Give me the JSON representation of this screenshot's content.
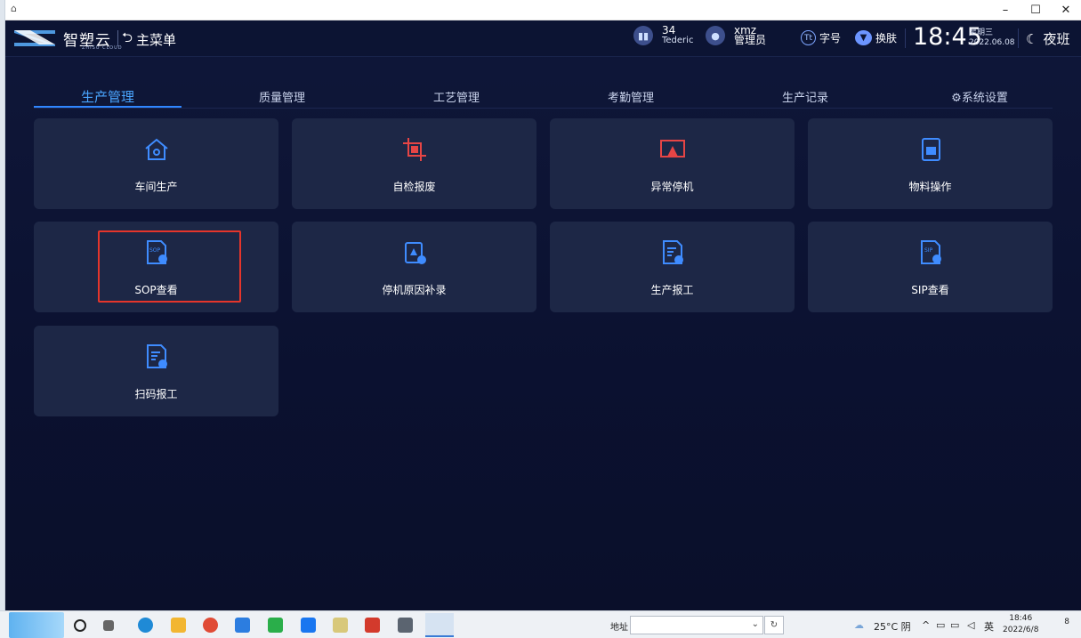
{
  "window": {
    "controls": {
      "minimize": "–",
      "maximize": "☐",
      "close": "✕"
    }
  },
  "header": {
    "brand": "智塑云",
    "brand_sub": "ZHISU CLOUD",
    "back_label": "主菜单",
    "user_count": "34",
    "user_name": "Tederic",
    "account": "xmz",
    "role": "管理员",
    "font_label": "字号",
    "skin_label": "换肤",
    "time": "18:45",
    "weekday": "星期三",
    "date": "2022.06.08",
    "shift": "夜班"
  },
  "tabs": [
    {
      "label": "生产管理",
      "active": true
    },
    {
      "label": "质量管理",
      "active": false
    },
    {
      "label": "工艺管理",
      "active": false
    },
    {
      "label": "考勤管理",
      "active": false
    },
    {
      "label": "生产记录",
      "active": false
    },
    {
      "label": "⚙系统设置",
      "active": false
    }
  ],
  "cards": [
    {
      "label": "车间生产",
      "icon": "workshop-icon",
      "color": "#3f8cff"
    },
    {
      "label": "自检报废",
      "icon": "crop-scrap-icon",
      "color": "#e64545"
    },
    {
      "label": "异常停机",
      "icon": "alarm-monitor-icon",
      "color": "#e64545"
    },
    {
      "label": "物料操作",
      "icon": "material-box-icon",
      "color": "#3f8cff"
    },
    {
      "label": "SOP查看",
      "icon": "sop-doc-icon",
      "color": "#3f8cff",
      "highlighted": true
    },
    {
      "label": "停机原因补录",
      "icon": "clipboard-add-icon",
      "color": "#3f8cff"
    },
    {
      "label": "生产报工",
      "icon": "report-doc-icon",
      "color": "#3f8cff"
    },
    {
      "label": "SIP查看",
      "icon": "sip-doc-icon",
      "color": "#3f8cff"
    },
    {
      "label": "扫码报工",
      "icon": "scan-report-icon",
      "color": "#3f8cff"
    }
  ],
  "taskbar": {
    "address_label": "地址",
    "weather": "25°C 阴",
    "ime": "英",
    "clock_time": "18:46",
    "clock_date": "2022/6/8",
    "notifications": "8"
  }
}
